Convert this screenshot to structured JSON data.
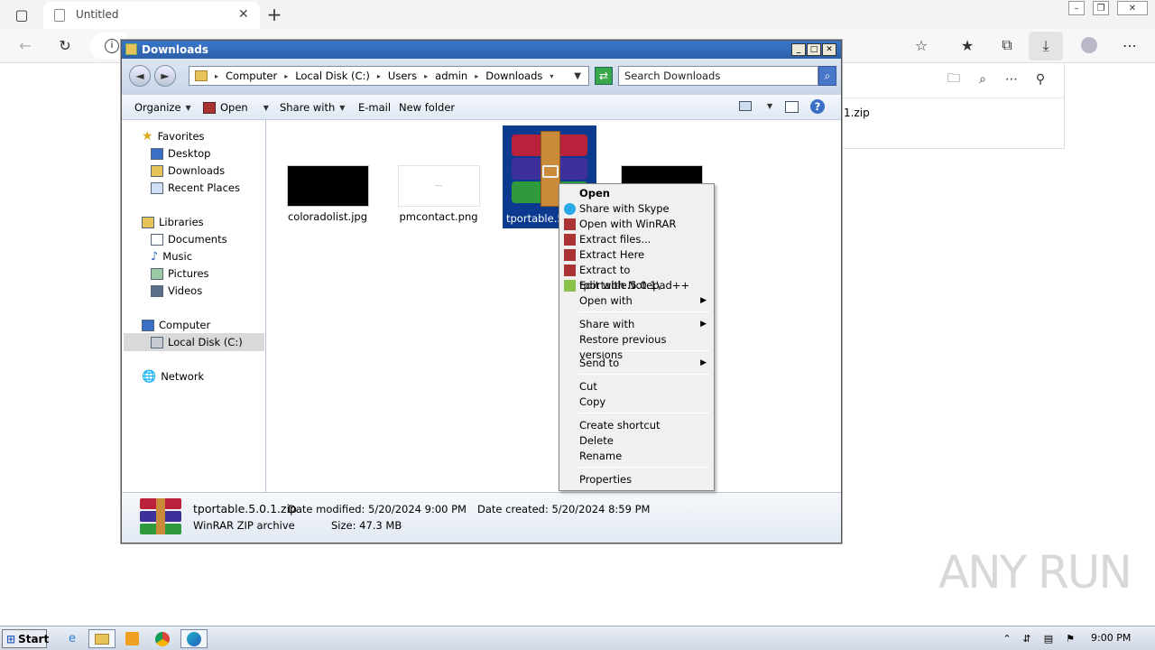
{
  "browser": {
    "tab_title": "Untitled",
    "download_item": "1.zip"
  },
  "explorer": {
    "title": "Downloads",
    "breadcrumb": [
      "Computer",
      "Local Disk (C:)",
      "Users",
      "admin",
      "Downloads"
    ],
    "search_placeholder": "Search Downloads",
    "toolbar": {
      "organize": "Organize",
      "open": "Open",
      "share_with": "Share with",
      "email": "E-mail",
      "new_folder": "New folder"
    },
    "nav": {
      "favorites": "Favorites",
      "desktop": "Desktop",
      "downloads": "Downloads",
      "recent_places": "Recent Places",
      "libraries": "Libraries",
      "documents": "Documents",
      "music": "Music",
      "pictures": "Pictures",
      "videos": "Videos",
      "computer": "Computer",
      "local_disk": "Local Disk (C:)",
      "network": "Network"
    },
    "files": {
      "f1": "coloradolist.jpg",
      "f2": "pmcontact.png",
      "f3": "tportable.5"
    },
    "details": {
      "name": "tportable.5.0.1.zip",
      "type": "WinRAR ZIP archive",
      "date_modified": "Date modified: 5/20/2024 9:00 PM",
      "size": "Size: 47.3 MB",
      "date_created": "Date created: 5/20/2024 8:59 PM"
    }
  },
  "context_menu": {
    "open": "Open",
    "share_skype": "Share with Skype",
    "open_winrar": "Open with WinRAR",
    "extract_files": "Extract files...",
    "extract_here": "Extract Here",
    "extract_to": "Extract to tportable.5.0.1\\",
    "edit_notepad": "Edit with Notepad++",
    "open_with": "Open with",
    "share_with": "Share with",
    "restore": "Restore previous versions",
    "send_to": "Send to",
    "cut": "Cut",
    "copy": "Copy",
    "create_shortcut": "Create shortcut",
    "delete": "Delete",
    "rename": "Rename",
    "properties": "Properties"
  },
  "taskbar": {
    "start": "Start",
    "clock": "9:00 PM"
  },
  "watermark": "ANY RUN"
}
